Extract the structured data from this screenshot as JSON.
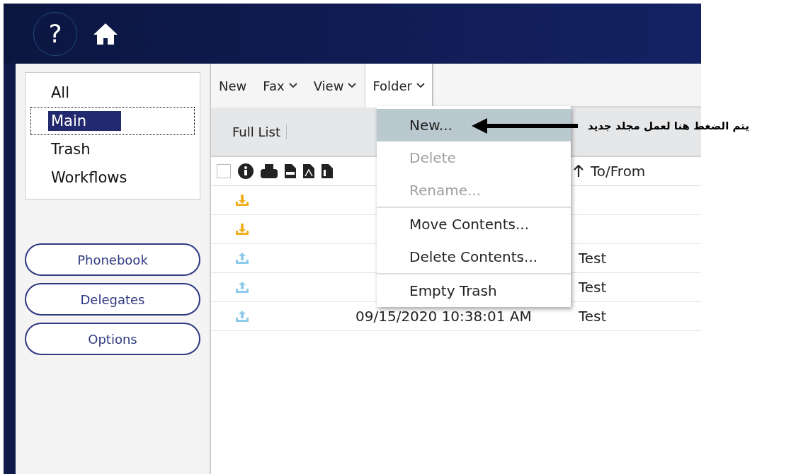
{
  "header": {
    "help_label": "?"
  },
  "sidebar": {
    "folders": [
      {
        "label": "All",
        "selected": false
      },
      {
        "label": "Main",
        "selected": true
      },
      {
        "label": "Trash",
        "selected": false
      },
      {
        "label": "Workflows",
        "selected": false
      }
    ],
    "buttons": [
      "Phonebook",
      "Delegates",
      "Options"
    ]
  },
  "toolbar": {
    "menus": [
      {
        "label": "New",
        "kind": "plain",
        "open": false
      },
      {
        "label": "Fax",
        "kind": "dropdown",
        "open": false
      },
      {
        "label": "View",
        "kind": "dropdown",
        "open": false
      },
      {
        "label": "Folder",
        "kind": "dropdown",
        "open": true
      }
    ]
  },
  "subbar": {
    "label": "Full List"
  },
  "table": {
    "select_all": {
      "checked": false
    },
    "sort_column": {
      "label": "To/From"
    },
    "rows": [
      {
        "kind": "received"
      },
      {
        "kind": "received"
      },
      {
        "kind": "sent",
        "to_from": "Test"
      },
      {
        "kind": "sent",
        "to_from": "Test"
      },
      {
        "kind": "sent",
        "date": "09/15/2020 10:38:01 AM",
        "to_from": "Test"
      }
    ]
  },
  "folder_menu": {
    "groups": [
      [
        {
          "label": "New...",
          "selected": true,
          "disabled": false
        },
        {
          "label": "Delete",
          "selected": false,
          "disabled": true
        },
        {
          "label": "Rename...",
          "selected": false,
          "disabled": true
        }
      ],
      [
        {
          "label": "Move Contents...",
          "selected": false,
          "disabled": false
        },
        {
          "label": "Delete Contents...",
          "selected": false,
          "disabled": false
        }
      ],
      [
        {
          "label": "Empty Trash",
          "selected": false,
          "disabled": false
        }
      ]
    ]
  },
  "annotation": {
    "text": "يتم الضغط هنا لعمل مجلد جديد"
  }
}
